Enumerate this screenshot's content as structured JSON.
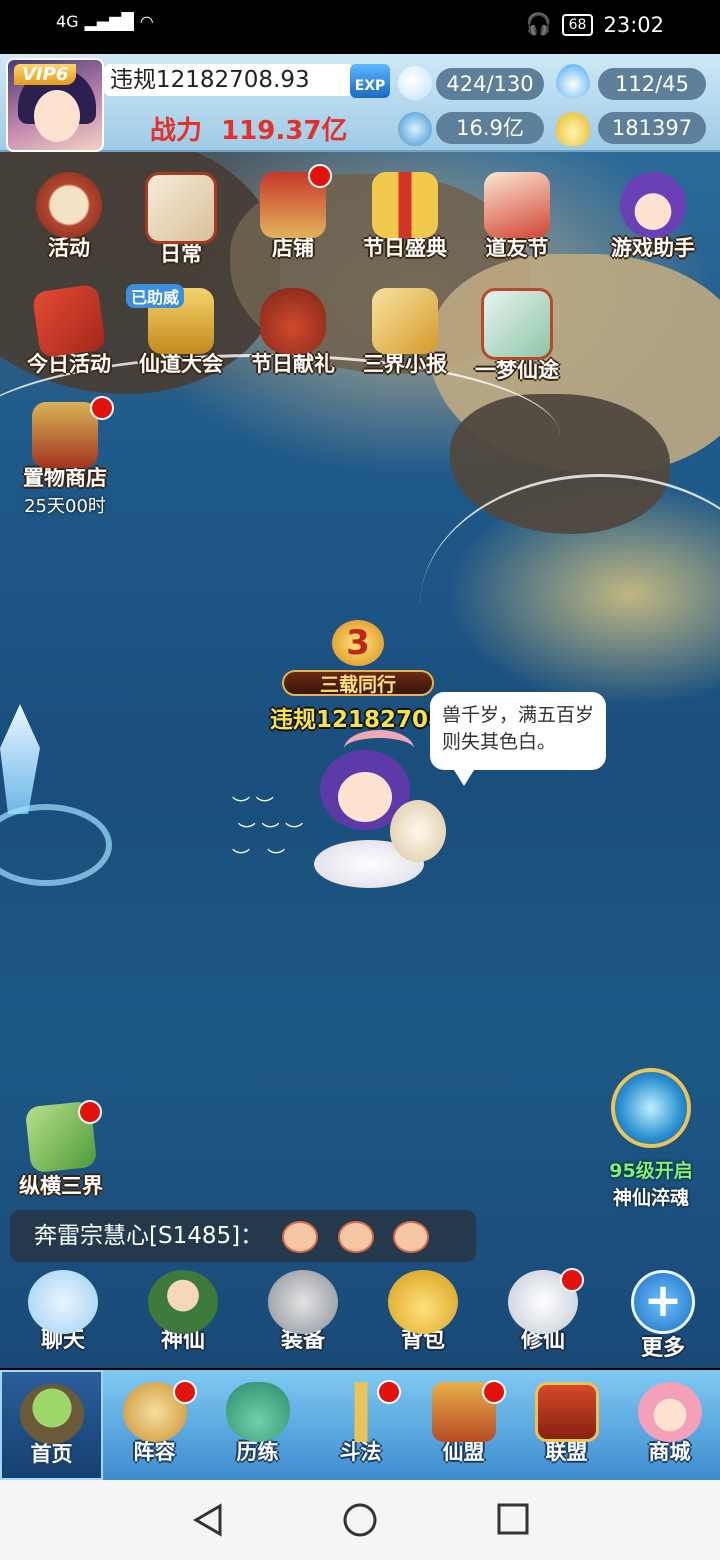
{
  "status_bar": {
    "signal": "4G",
    "battery": "68",
    "time": "23:02"
  },
  "hud": {
    "vip": "VIP6",
    "player_name": "违规12182708",
    "exp_value": ".93",
    "exp_badge": "EXP",
    "power_label": "战力",
    "power_value": "119.37亿",
    "stamina": "424/130",
    "energy": "112/45",
    "gems": "16.9亿",
    "gold": "181397"
  },
  "activity_icons": [
    {
      "label": "活动",
      "icon": "drum-icon"
    },
    {
      "label": "日常",
      "icon": "scroll-brush-icon"
    },
    {
      "label": "店铺",
      "icon": "shop-pavilion-icon"
    },
    {
      "label": "节日盛典",
      "icon": "gift-box-icon"
    },
    {
      "label": "道友节",
      "icon": "festival-banner-icon"
    },
    {
      "label": "游戏助手",
      "icon": "assistant-girl-icon"
    },
    {
      "label": "今日活动",
      "icon": "flag-icon"
    },
    {
      "label": "仙道大会",
      "icon": "golden-palace-icon",
      "badge": "已助威"
    },
    {
      "label": "节日献礼",
      "icon": "lucky-bag-icon"
    },
    {
      "label": "三界小报",
      "icon": "newspaper-scroll-icon"
    },
    {
      "label": "一梦仙途",
      "icon": "dream-scroll-icon"
    },
    {
      "label": "置物商店",
      "icon": "storage-shop-icon",
      "timer": "25天00时"
    }
  ],
  "world": {
    "title_badge": "三载同行",
    "title_number": "3",
    "character_name": "违规12182708",
    "speech": "兽千岁，满五百岁则失其色白。",
    "left_feature": "纵横三界",
    "right_feature_line1": "95级开启",
    "right_feature_line2": "神仙淬魂"
  },
  "chat": {
    "sender": "奔雷宗慧心[S1485]："
  },
  "function_row": [
    {
      "label": "聊天",
      "icon": "chat-bubble-icon"
    },
    {
      "label": "神仙",
      "icon": "immortal-hero-icon"
    },
    {
      "label": "装备",
      "icon": "armor-icon"
    },
    {
      "label": "背包",
      "icon": "money-bag-icon"
    },
    {
      "label": "修仙",
      "icon": "crane-icon"
    },
    {
      "label": "更多",
      "icon": "plus-icon"
    }
  ],
  "tabs": [
    {
      "label": "首页",
      "icon": "floating-island-icon"
    },
    {
      "label": "阵容",
      "icon": "formation-icon"
    },
    {
      "label": "历练",
      "icon": "gourd-icon"
    },
    {
      "label": "斗法",
      "icon": "sword-icon"
    },
    {
      "label": "仙盟",
      "icon": "alliance-palace-icon"
    },
    {
      "label": "联盟",
      "icon": "alliance-banner-icon"
    },
    {
      "label": "商城",
      "icon": "fox-girl-icon"
    }
  ],
  "nav": {
    "back": "back-icon",
    "home": "home-icon",
    "recents": "recents-icon"
  },
  "colors": {
    "accent_red": "#e3120c",
    "power_red": "#e3302a",
    "name_yellow": "#f6e34a"
  }
}
